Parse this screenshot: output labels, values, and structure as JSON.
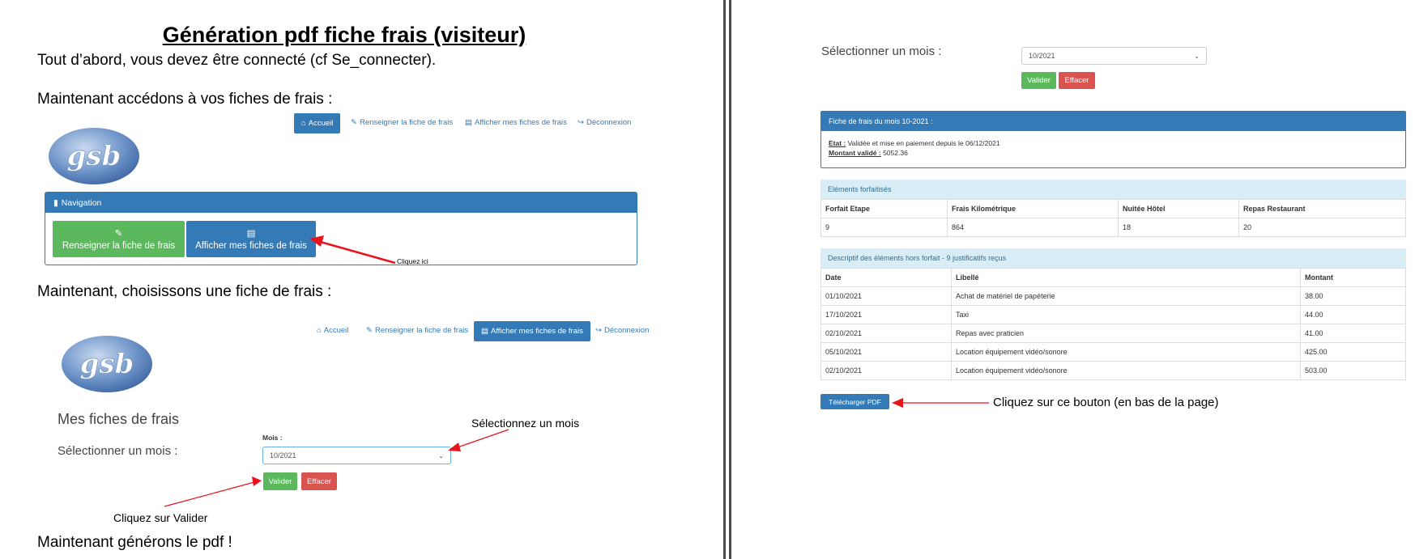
{
  "left": {
    "title": "Génération pdf fiche frais (visiteur)",
    "intro": "Tout d’abord, vous devez être connecté (cf Se_connecter).",
    "step1": "Maintenant accédons à vos fiches de frais :",
    "step2": "Maintenant, choisissons une fiche de frais :",
    "step3": "Maintenant générons le pdf !",
    "logo_text": "gsb",
    "nav1": {
      "accueil": "Accueil",
      "renseigner": "Renseigner la fiche de frais",
      "afficher": "Afficher mes fiches de frais",
      "deconnexion": "Déconnexion"
    },
    "navigation_panel": {
      "heading": "Navigation",
      "btn_renseigner": "Renseigner la fiche de frais",
      "btn_afficher": "Afficher mes fiches de frais"
    },
    "annotation_cliquez_ici": "Cliquez ici",
    "nav2": {
      "accueil": "Accueil",
      "renseigner": "Renseigner la fiche de frais",
      "afficher": "Afficher mes fiches de frais",
      "deconnexion": "Déconnexion"
    },
    "form": {
      "heading": "Mes fiches de frais",
      "select_label": "Sélectionner un mois :",
      "mois_label": "Mois :",
      "mois_value": "10/2021",
      "valider": "Valider",
      "effacer": "Effacer"
    },
    "annotation_selectionnez": "Sélectionnez un mois",
    "annotation_valider": "Cliquez sur Valider"
  },
  "right": {
    "select_label": "Sélectionner un mois :",
    "mois_value": "10/2021",
    "valider": "Valider",
    "effacer": "Effacer",
    "fiche_heading": "Fiche de frais du mois 10-2021 :",
    "etat_label": "Etat :",
    "etat_value": "Validée et mise en paiement depuis le 06/12/2021",
    "montant_label": "Montant validé :",
    "montant_value": "5052.36",
    "forfait_heading": "Eléments forfaitisés",
    "forfait_headers": [
      "Forfait Etape",
      "Frais Kilométrique",
      "Nuitée Hôtel",
      "Repas Restaurant"
    ],
    "forfait_values": [
      "9",
      "864",
      "18",
      "20"
    ],
    "hors_forfait_heading": "Descriptif des éléments hors forfait - 9 justificatifs reçus",
    "hors_forfait_headers": [
      "Date",
      "Libellé",
      "Montant"
    ],
    "hors_forfait_rows": [
      [
        "01/10/2021",
        "Achat de matériel de papèterie",
        "38.00"
      ],
      [
        "17/10/2021",
        "Taxi",
        "44.00"
      ],
      [
        "02/10/2021",
        "Repas avec praticien",
        "41.00"
      ],
      [
        "05/10/2021",
        "Location équipement vidéo/sonore",
        "425.00"
      ],
      [
        "02/10/2021",
        "Location équipement vidéo/sonore",
        "503.00"
      ]
    ],
    "telecharger": "Télécharger PDF",
    "annotation_bouton": "Cliquez sur ce bouton (en bas de la page)"
  },
  "colors": {
    "primary": "#337ab7",
    "success": "#5cb85c",
    "danger": "#d9534f",
    "info_bg": "#d9edf7",
    "arrow": "#e8131b"
  }
}
